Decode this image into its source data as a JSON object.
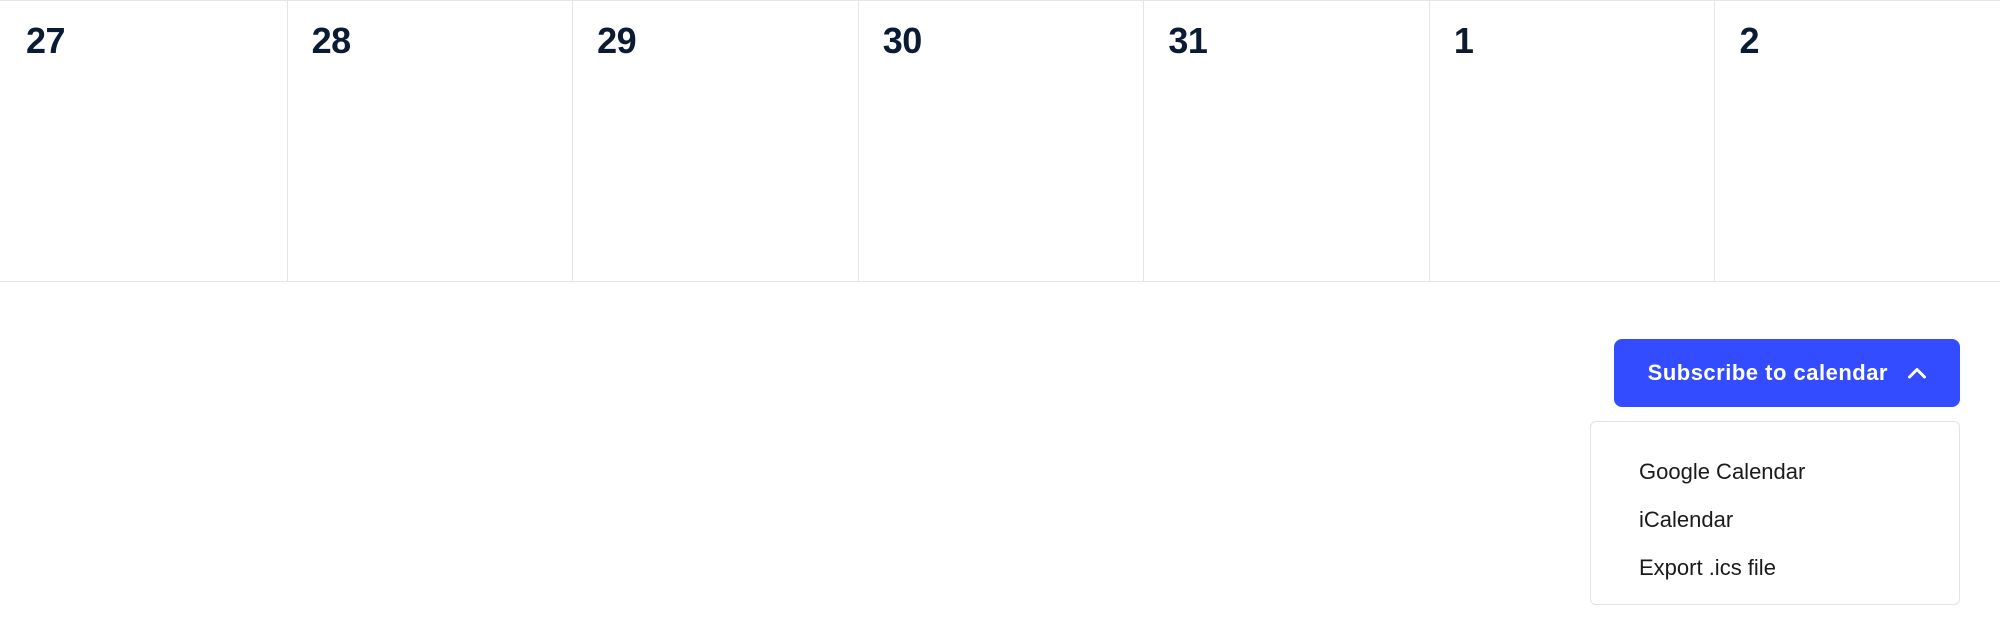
{
  "calendar": {
    "row": [
      {
        "day": "27"
      },
      {
        "day": "28"
      },
      {
        "day": "29"
      },
      {
        "day": "30"
      },
      {
        "day": "31"
      },
      {
        "day": "1"
      },
      {
        "day": "2"
      }
    ]
  },
  "subscribe": {
    "button_label": "Subscribe to calendar",
    "options": {
      "google": "Google Calendar",
      "icalendar": "iCalendar",
      "export_ics": "Export .ics file"
    }
  },
  "colors": {
    "accent": "#334cff",
    "text_dark": "#0a1b33",
    "border": "#e5e5e5"
  }
}
